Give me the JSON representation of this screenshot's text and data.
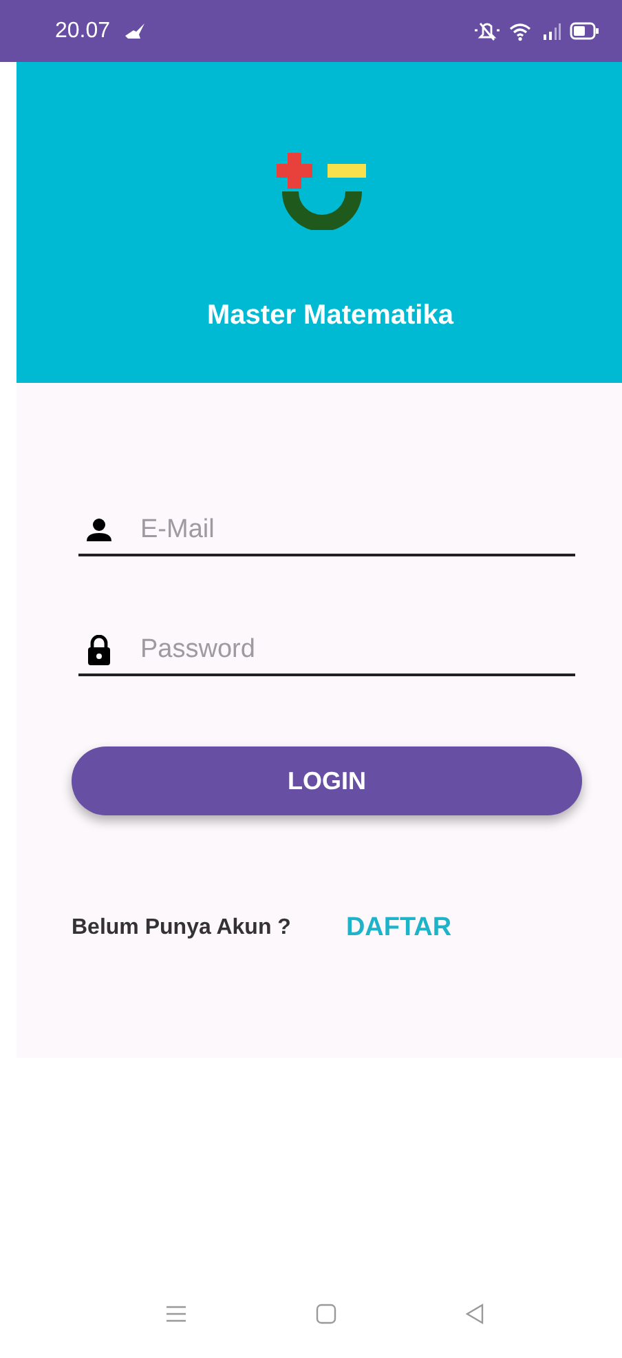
{
  "status_bar": {
    "time": "20.07"
  },
  "header": {
    "title": "Master Matematika"
  },
  "form": {
    "fields": [
      {
        "kind": "email",
        "placeholder": "E-Mail"
      },
      {
        "kind": "password",
        "placeholder": "Password"
      }
    ],
    "login_button": "LOGIN"
  },
  "register": {
    "prompt": "Belum Punya Akun ?",
    "link": "DAFTAR"
  }
}
